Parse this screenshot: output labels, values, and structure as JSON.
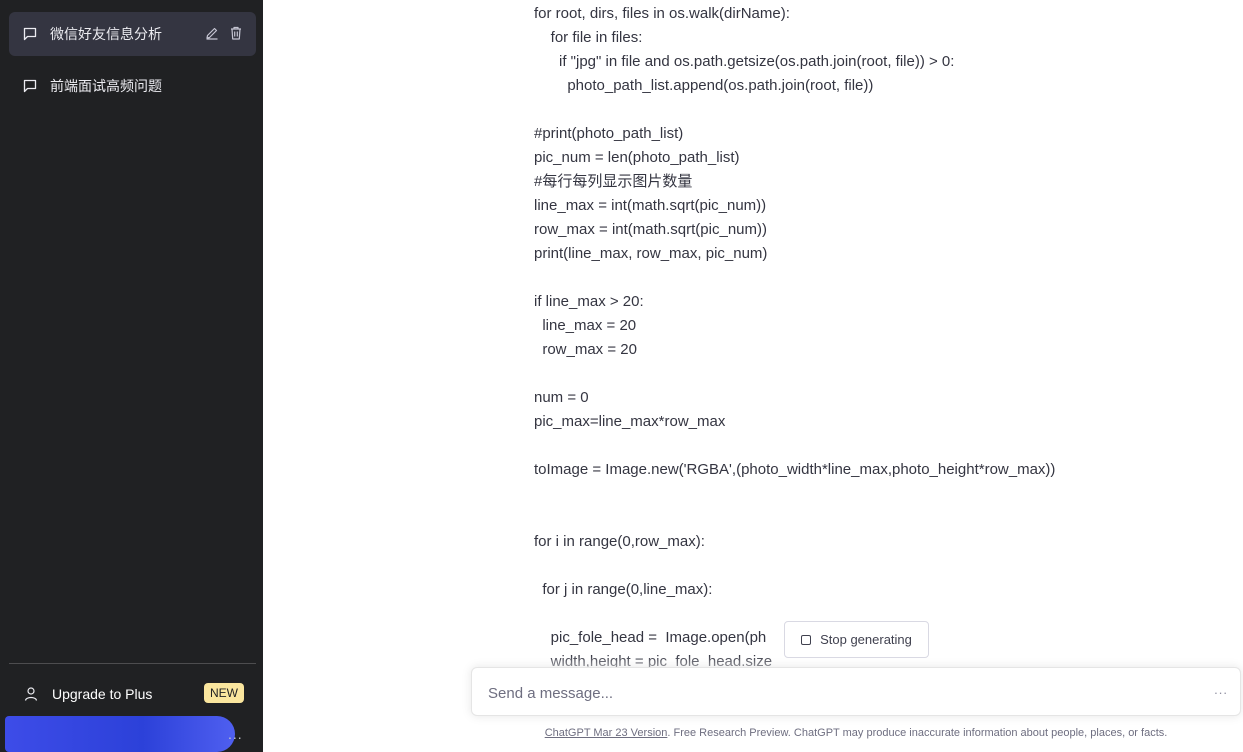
{
  "sidebar": {
    "conversations": [
      {
        "title": "微信好友信息分析",
        "active": true
      },
      {
        "title": "前端面试高频问题",
        "active": false
      }
    ],
    "upgrade": {
      "label": "Upgrade to Plus",
      "badge": "NEW"
    },
    "account_more": "..."
  },
  "main": {
    "code_lines": [
      "for root, dirs, files in os.walk(dirName):",
      "    for file in files:",
      "      if \"jpg\" in file and os.path.getsize(os.path.join(root, file)) > 0:",
      "        photo_path_list.append(os.path.join(root, file))",
      "",
      "#print(photo_path_list)",
      "pic_num = len(photo_path_list)",
      "#每行每列显示图片数量",
      "line_max = int(math.sqrt(pic_num))",
      "row_max = int(math.sqrt(pic_num))",
      "print(line_max, row_max, pic_num)",
      "",
      "if line_max > 20:",
      "  line_max = 20",
      "  row_max = 20",
      "",
      "num = 0",
      "pic_max=line_max*row_max",
      "",
      "toImage = Image.new('RGBA',(photo_width*line_max,photo_height*row_max))",
      "",
      "",
      "for i in range(0,row_max):",
      "",
      "  for j in range(0,line_max):",
      "",
      "    pic_fole_head =  Image.open(ph",
      "    width,height = pic_fole_head.size"
    ],
    "stop_button": "Stop generating",
    "composer": {
      "placeholder": "Send a message...",
      "more": "..."
    },
    "footer": {
      "link": "ChatGPT Mar 23 Version",
      "text": ". Free Research Preview. ChatGPT may produce inaccurate information about people, places, or facts."
    }
  }
}
